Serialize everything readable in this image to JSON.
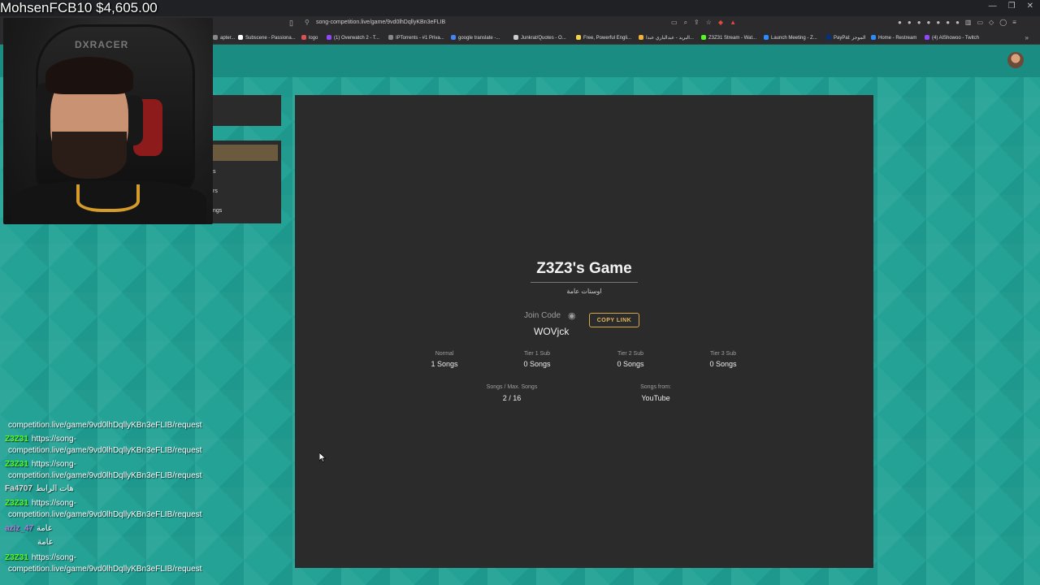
{
  "overlay": {
    "donation_text": "MohsenFCB10 $4,605.00"
  },
  "browser": {
    "url": "song-competition.live/game/9vd0lhDqllyKBn3eFLIB",
    "bookmarks": [
      {
        "label": "apter...",
        "color": "#888888"
      },
      {
        "label": "Subscene - Passiona...",
        "color": "#ffffff"
      },
      {
        "label": "logo",
        "color": "#e05050"
      },
      {
        "label": "(1) Overwatch 2 - T...",
        "color": "#9146ff"
      },
      {
        "label": "IPTorrents - #1 Priva...",
        "color": "#888888"
      },
      {
        "label": "google translate -...",
        "color": "#4285f4"
      },
      {
        "label": "Junkrat/Quotes - O...",
        "color": "#cccccc"
      },
      {
        "label": "Free, Powerful Engli...",
        "color": "#f5d442"
      },
      {
        "label": "البريد - عبدالباري عبدا...",
        "color": "#f2b233"
      },
      {
        "label": "Z3Z31 Stream - Wat...",
        "color": "#53fc18"
      },
      {
        "label": "Launch Meeting - Z...",
        "color": "#2d8cff"
      },
      {
        "label": "PayPal: الموجز",
        "color": "#003087"
      },
      {
        "label": "Home - Restream",
        "color": "#2c8bfd"
      },
      {
        "label": "(4) AlShowoo - Twitch",
        "color": "#9146ff"
      }
    ]
  },
  "game": {
    "title": "Z3Z3's Game",
    "subtitle": "اوستات عامة",
    "join_label": "Join Code",
    "join_code": "WOVjck",
    "copy_button": "COPY LINK",
    "tiers": [
      {
        "label": "Normal",
        "value": "1 Songs"
      },
      {
        "label": "Tier 1 Sub",
        "value": "0 Songs"
      },
      {
        "label": "Tier 2 Sub",
        "value": "0 Songs"
      },
      {
        "label": "Tier 3 Sub",
        "value": "0 Songs"
      }
    ],
    "stats": [
      {
        "label": "Songs / Max. Songs",
        "value": "2 / 16"
      },
      {
        "label": "Songs from:",
        "value": "YouTube"
      }
    ]
  },
  "left_panel": {
    "labels": [
      "s",
      "rs",
      "ngs"
    ]
  },
  "chat": {
    "messages": [
      {
        "user": "",
        "text": "competition.live/game/9vd0lhDqllyKBn3eFLIB/request",
        "color": "#53fc18"
      },
      {
        "user": "Z3Z31",
        "text": "https://song-",
        "color": "#53fc18"
      },
      {
        "user": "",
        "text": "competition.live/game/9vd0lhDqllyKBn3eFLIB/request",
        "color": "#53fc18"
      },
      {
        "user": "Z3Z31",
        "text": "https://song-",
        "color": "#53fc18"
      },
      {
        "user": "",
        "text": "competition.live/game/9vd0lhDqllyKBn3eFLIB/request",
        "color": "#53fc18"
      },
      {
        "user": "Fa4707",
        "text": "هات الرابط",
        "color": "#dddddd"
      },
      {
        "user": "Z3Z31",
        "text": "https://song-",
        "color": "#53fc18"
      },
      {
        "user": "",
        "text": "competition.live/game/9vd0lhDqllyKBn3eFLIB/request",
        "color": "#53fc18"
      },
      {
        "user": "aziz_47",
        "text": "عامة",
        "color": "#b07de0"
      },
      {
        "user": "",
        "text": "عامة",
        "color": "#2e7bd6"
      },
      {
        "user": "Z3Z31",
        "text": "https://song-",
        "color": "#53fc18"
      },
      {
        "user": "",
        "text": "competition.live/game/9vd0lhDqllyKBn3eFLIB/request",
        "color": "#53fc18"
      }
    ]
  }
}
